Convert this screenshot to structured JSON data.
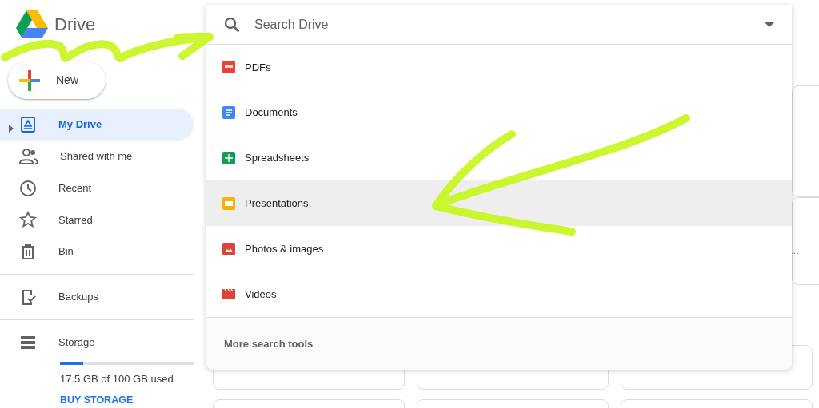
{
  "app": {
    "logo_text": "Drive"
  },
  "new_button": {
    "label": "New"
  },
  "sidebar": {
    "groups": [
      {
        "items": [
          {
            "label": "My Drive",
            "kind": "drive",
            "selected": true,
            "expanded": false
          },
          {
            "label": "Shared with me",
            "kind": "shared",
            "selected": false
          },
          {
            "label": "Recent",
            "kind": "recent",
            "selected": false
          },
          {
            "label": "Starred",
            "kind": "starred",
            "selected": false
          },
          {
            "label": "Bin",
            "kind": "bin",
            "selected": false
          }
        ]
      },
      {
        "items": [
          {
            "label": "Backups",
            "kind": "backups",
            "selected": false
          }
        ]
      }
    ],
    "storage": {
      "label": "Storage",
      "level": 0.175,
      "usage": "17.5 GB of 100 GB used",
      "action": "BUY STORAGE"
    }
  },
  "search": {
    "placeholder": "Search Drive",
    "menu": [
      {
        "label": "PDFs",
        "kind": "pdf",
        "selected": false
      },
      {
        "label": "Documents",
        "kind": "doc",
        "selected": false
      },
      {
        "label": "Spreadsheets",
        "kind": "sheet",
        "selected": false
      },
      {
        "label": "Presentations",
        "kind": "slides",
        "selected": true
      },
      {
        "label": "Photos & images",
        "kind": "image",
        "selected": false
      },
      {
        "label": "Videos",
        "kind": "video",
        "selected": false
      }
    ],
    "footer": "More search tools"
  },
  "background_card_text": "…"
}
